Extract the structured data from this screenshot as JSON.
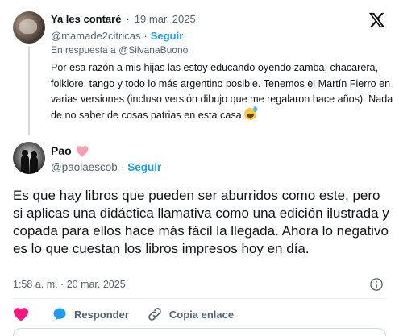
{
  "parent_tweet": {
    "display_name": "Ya les contaré",
    "separator": "·",
    "date": "19 mar. 2025",
    "handle": "@mamade2citricas",
    "follow_label": "Seguir",
    "reply_prefix": "En respuesta a",
    "reply_to": "@SilvanaBuono",
    "text": "Por esa razón a mis hijas las estoy educando oyendo zamba, chacarera, folklore, tango y todo lo más argentino posible. Tenemos el Martín Fierro en varias versiones (incluso versión dibujo que me regalaron hace años). Nada de no saber de cosas patrias en esta casa"
  },
  "main_tweet": {
    "display_name": "Pao",
    "handle": "@paolaescob",
    "separator": "·",
    "follow_label": "Seguir",
    "text": "Es que hay libros que pueden ser aburridos como este, pero si aplicas una didáctica llamativa como una edición ilustrada y copada para ellos hace más fácil la llegada. Ahora lo negativo es lo que cuestan los libros impresos hoy en día.",
    "timestamp": "1:58 a. m. · 20 mar. 2025"
  },
  "actions": {
    "reply_label": "Responder",
    "copy_label": "Copia enlace"
  },
  "icons": [
    "x-logo-icon",
    "pink-heart-icon",
    "sweat-smile-icon",
    "info-icon",
    "heart-icon",
    "reply-icon",
    "link-icon"
  ],
  "colors": {
    "accent": "#1d9bf0",
    "like": "#f91880",
    "heart_emoji": "#f4a0b4",
    "secondary_text": "#536471",
    "primary_text": "#0f1419"
  }
}
